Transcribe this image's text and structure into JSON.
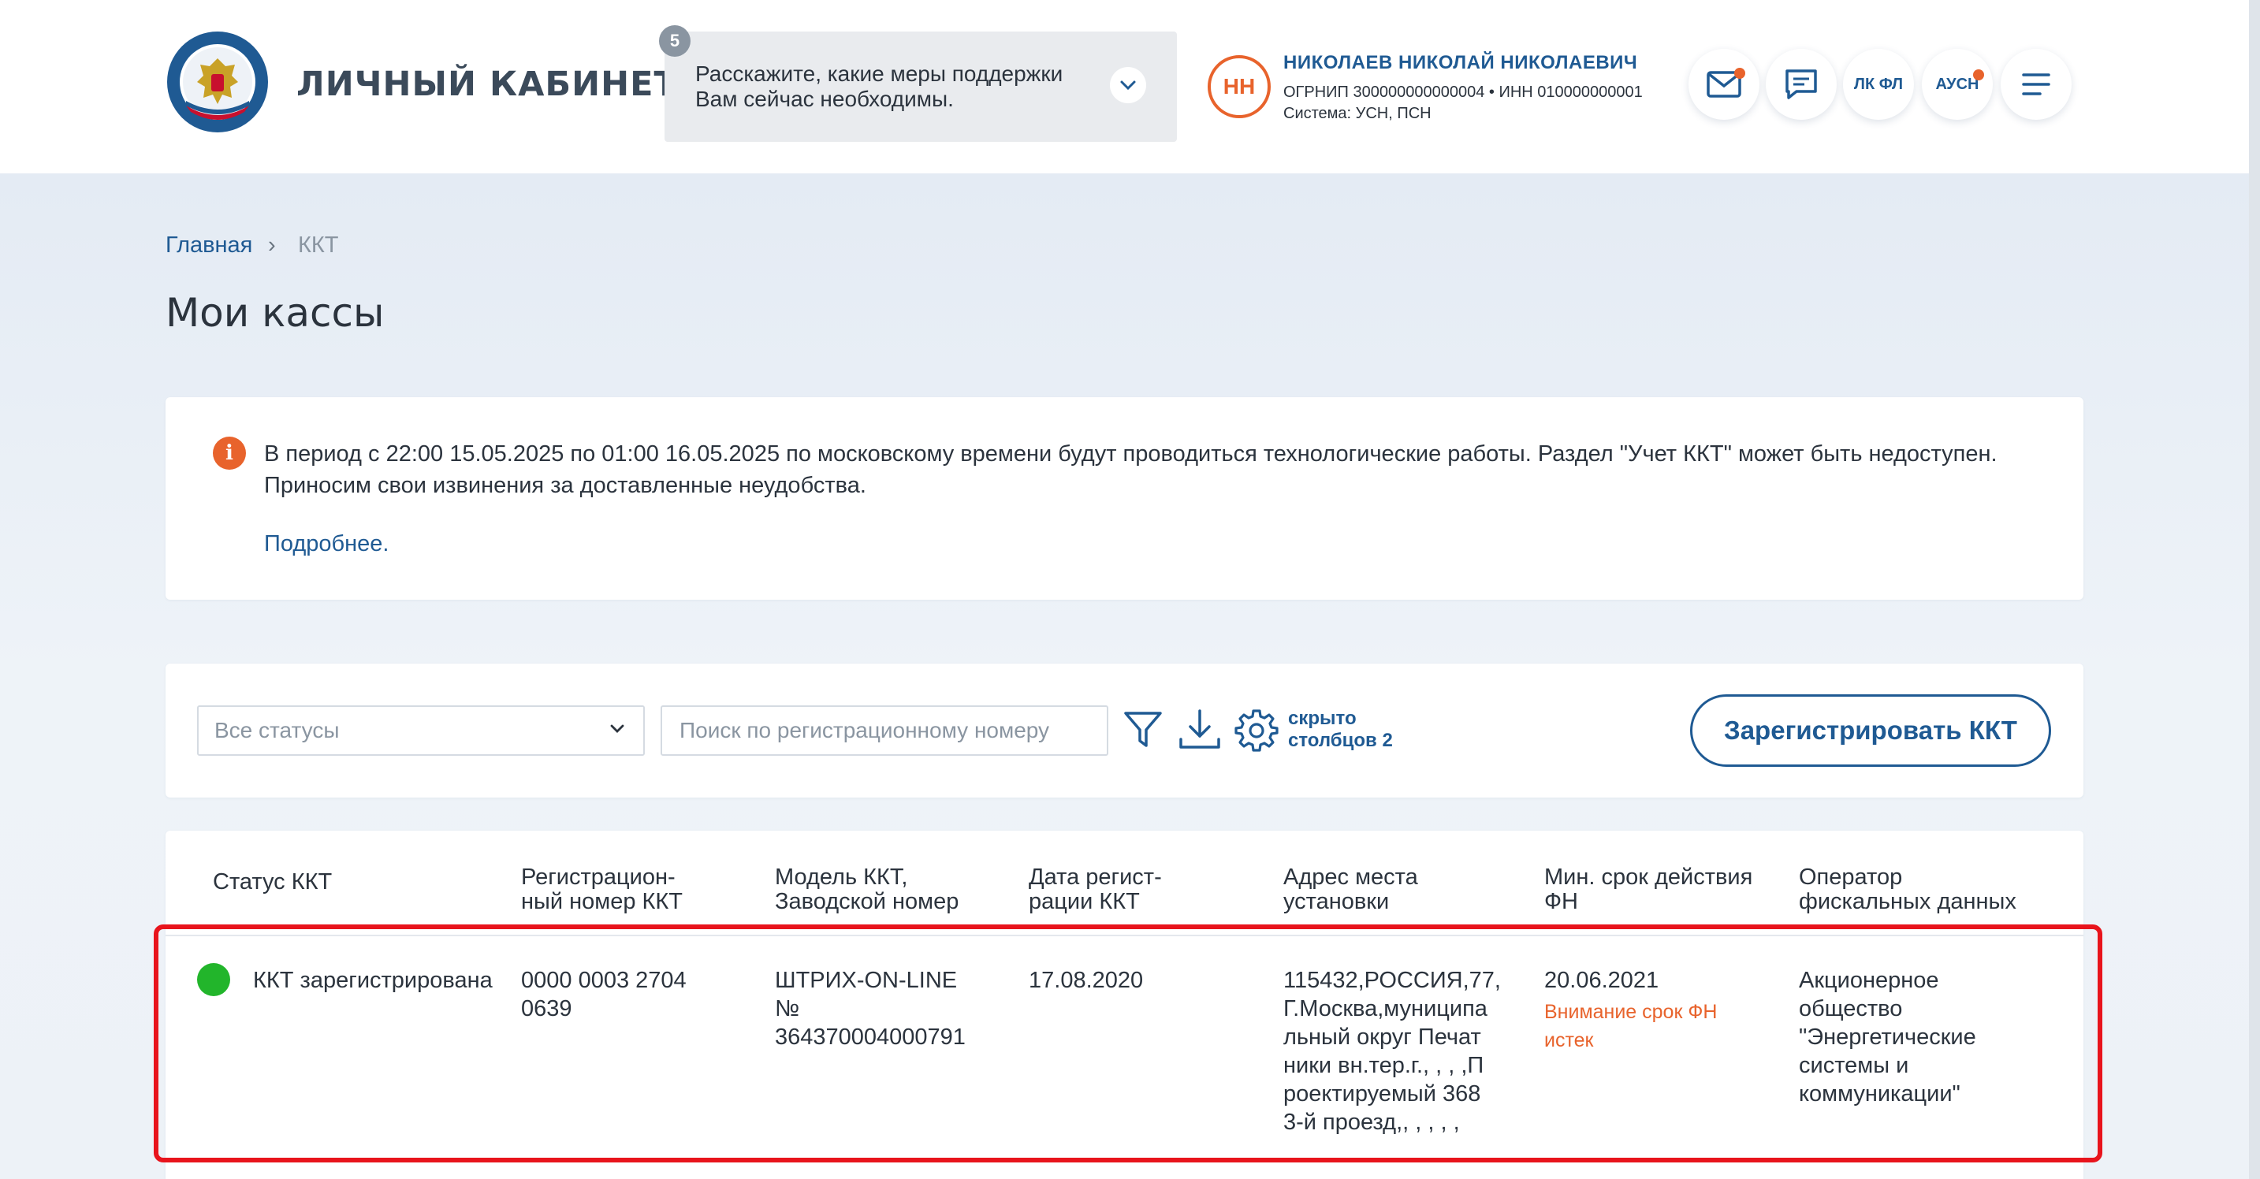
{
  "header": {
    "brand_title": "ЛИЧНЫЙ КАБИНЕТ ИП",
    "support": {
      "badge": "5",
      "text": "Расскажите, какие меры поддержки Вам сейчас необходимы."
    },
    "user": {
      "initials": "НН",
      "name": "НИКОЛАЕВ НИКОЛАЙ НИКОЛАЕВИЧ",
      "ids": "ОГРНИП 300000000000004  •  ИНН 010000000001",
      "system": "Система: УСН, ПСН"
    },
    "icons": {
      "lk_fl": "ЛК ФЛ",
      "ausn": "АУСН"
    }
  },
  "breadcrumb": {
    "home": "Главная",
    "separator": "›",
    "current": "ККТ"
  },
  "page_title": "Мои кассы",
  "notice": {
    "icon": "i",
    "text": "В период с 22:00 15.05.2025 по 01:00 16.05.2025 по московскому времени будут проводиться технологические работы. Раздел \"Учет ККТ\" может быть недоступен. Приносим свои извинения за доставленные неудобства.",
    "link": "Подробнее."
  },
  "filters": {
    "status_select": "Все статусы",
    "search_placeholder": "Поиск по регистрационному номеру",
    "hidden_columns": "скрыто\nстолбцов 2",
    "register_button": "Зарегистрировать ККТ"
  },
  "table": {
    "headers": {
      "status": "Статус ККТ",
      "reg_number": "Регистрацион-\nный номер ККТ",
      "model": "Модель ККТ,\nЗаводской номер",
      "reg_date": "Дата регист-\nрации ККТ",
      "address": "Адрес места\nустановки",
      "fn_term": "Мин. срок действия\nФН",
      "operator": "Оператор\nфискальных данных"
    },
    "rows": [
      {
        "status": "ККТ зарегистрирована",
        "status_color": "#22b52b",
        "reg_number": "0000 0003 2704\n0639",
        "model": "ШТРИХ-ON-LINE\n№\n364370004000791",
        "reg_date": "17.08.2020",
        "address": "115432,РОССИЯ,77,\nГ.Москва,муниципа\nльный округ Печат\nники вн.тер.г., , , ,П\nроектируемый 368\n3-й проезд,, , , , ,",
        "fn_term": "20.06.2021",
        "fn_warning": "Внимание срок ФН\nистек",
        "operator": "Акционерное\nобщество\n\"Энергетические\nсистемы и\nкоммуникации\""
      }
    ]
  },
  "colors": {
    "accent": "#1f5a93",
    "warning": "#e8632c",
    "highlight": "#e8141c",
    "status_ok": "#22b52b"
  }
}
